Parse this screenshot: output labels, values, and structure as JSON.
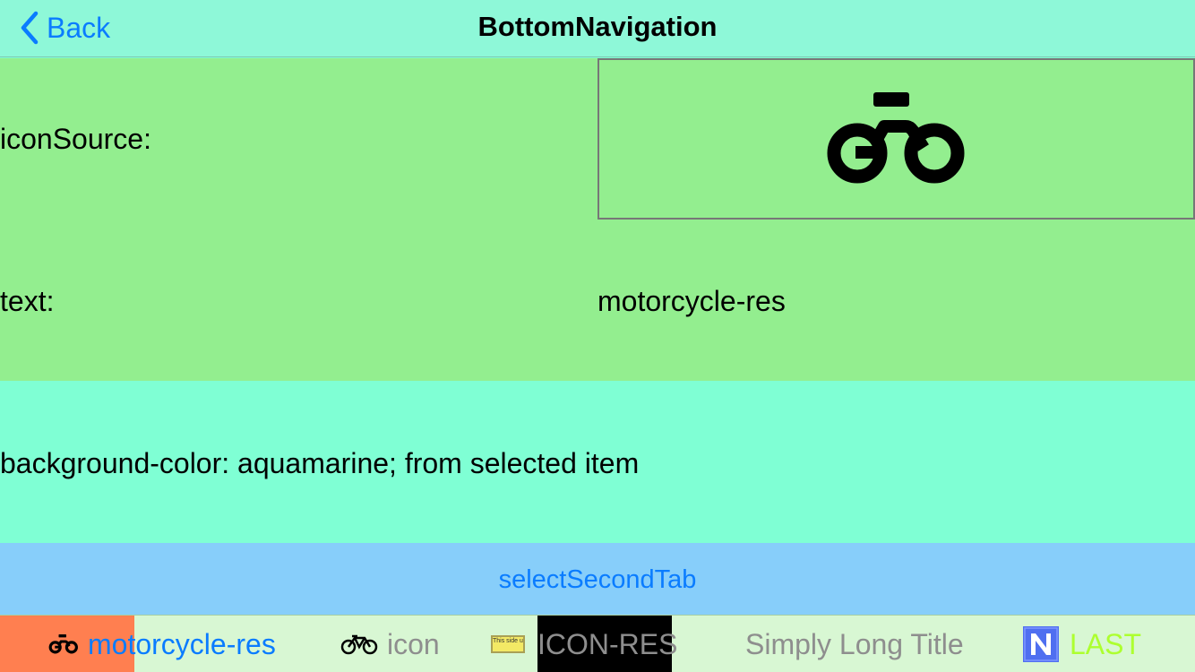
{
  "navbar": {
    "back_label": "Back",
    "title": "BottomNavigation"
  },
  "content": {
    "icon_source_label": "iconSource:",
    "text_label": "text:",
    "text_value": "motorcycle-res",
    "background_info": "background-color: aquamarine; from selected item"
  },
  "select_button": {
    "label": "selectSecondTab"
  },
  "tabs": [
    {
      "label": "motorcycle-res",
      "icon": "motorcycle-icon",
      "selected": true
    },
    {
      "label": "icon",
      "icon": "bicycle-icon",
      "selected": false
    },
    {
      "label": "ICON-RES",
      "icon": "this-side-up-icon",
      "icon_text": "This side up",
      "selected": false
    },
    {
      "label": "Simply Long Title",
      "icon": "",
      "selected": false
    },
    {
      "label": "LAST",
      "icon": "n-logo-icon",
      "selected": false
    }
  ],
  "colors": {
    "navbar_bg": "#8ef8d8",
    "content_bg": "#93ee8f",
    "info_bg": "#7fffd4",
    "button_bg": "#87cefa",
    "accent_blue": "#0a7cff",
    "tabbar_bg": "#d8f7d3",
    "tab1_bg": "#ff7f50",
    "tab3_bg": "#000000",
    "tab_inactive_text": "#8e8e8e",
    "tab5_text": "#adff2f"
  }
}
